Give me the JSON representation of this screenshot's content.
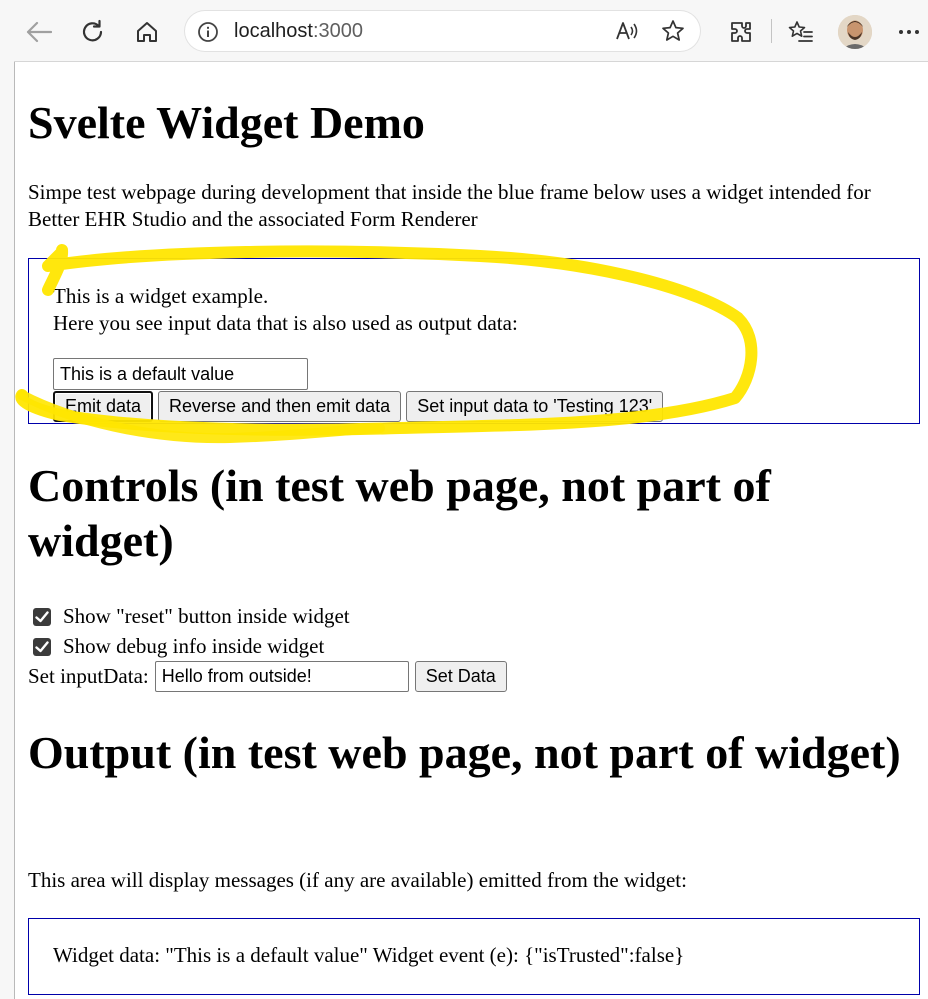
{
  "browser": {
    "url_host": "localhost",
    "url_port": ":3000",
    "icons": [
      "back-arrow-icon",
      "refresh-icon",
      "home-icon",
      "info-icon",
      "read-aloud-icon",
      "favorite-star-icon",
      "extensions-icon",
      "favorites-list-icon",
      "profile-avatar",
      "more-menu-icon"
    ],
    "more_label": "···"
  },
  "page": {
    "title": "Svelte Widget Demo",
    "intro": "Simpe test webpage during development that inside the blue frame below uses a widget intended for Better EHR Studio and the associated Form Renderer"
  },
  "widget": {
    "line1": "This is a widget example.",
    "line2": "Here you see input data that is also used as output data:",
    "input_value": "This is a default value",
    "buttons": {
      "emit": "Emit data",
      "reverse": "Reverse and then emit data",
      "set_testing": "Set input data to 'Testing 123'"
    },
    "highlight_color": "#ffe600"
  },
  "controls": {
    "title": "Controls (in test web page, not part of widget)",
    "checkbox_reset": {
      "label": "Show \"reset\" button inside widget",
      "checked": true
    },
    "checkbox_debug": {
      "label": "Show debug info inside widget",
      "checked": true
    },
    "set_label": "Set inputData:",
    "set_input_value": "Hello from outside!",
    "set_button": "Set Data"
  },
  "output": {
    "title": "Output (in test web page, not part of widget)",
    "description": "This area will display messages (if any are available) emitted from the widget:",
    "message": "Widget data: \"This is a default value\" Widget event (e): {\"isTrusted\":false}"
  },
  "colors": {
    "frame_border": "#0000aa",
    "highlight": "#ffe600"
  }
}
